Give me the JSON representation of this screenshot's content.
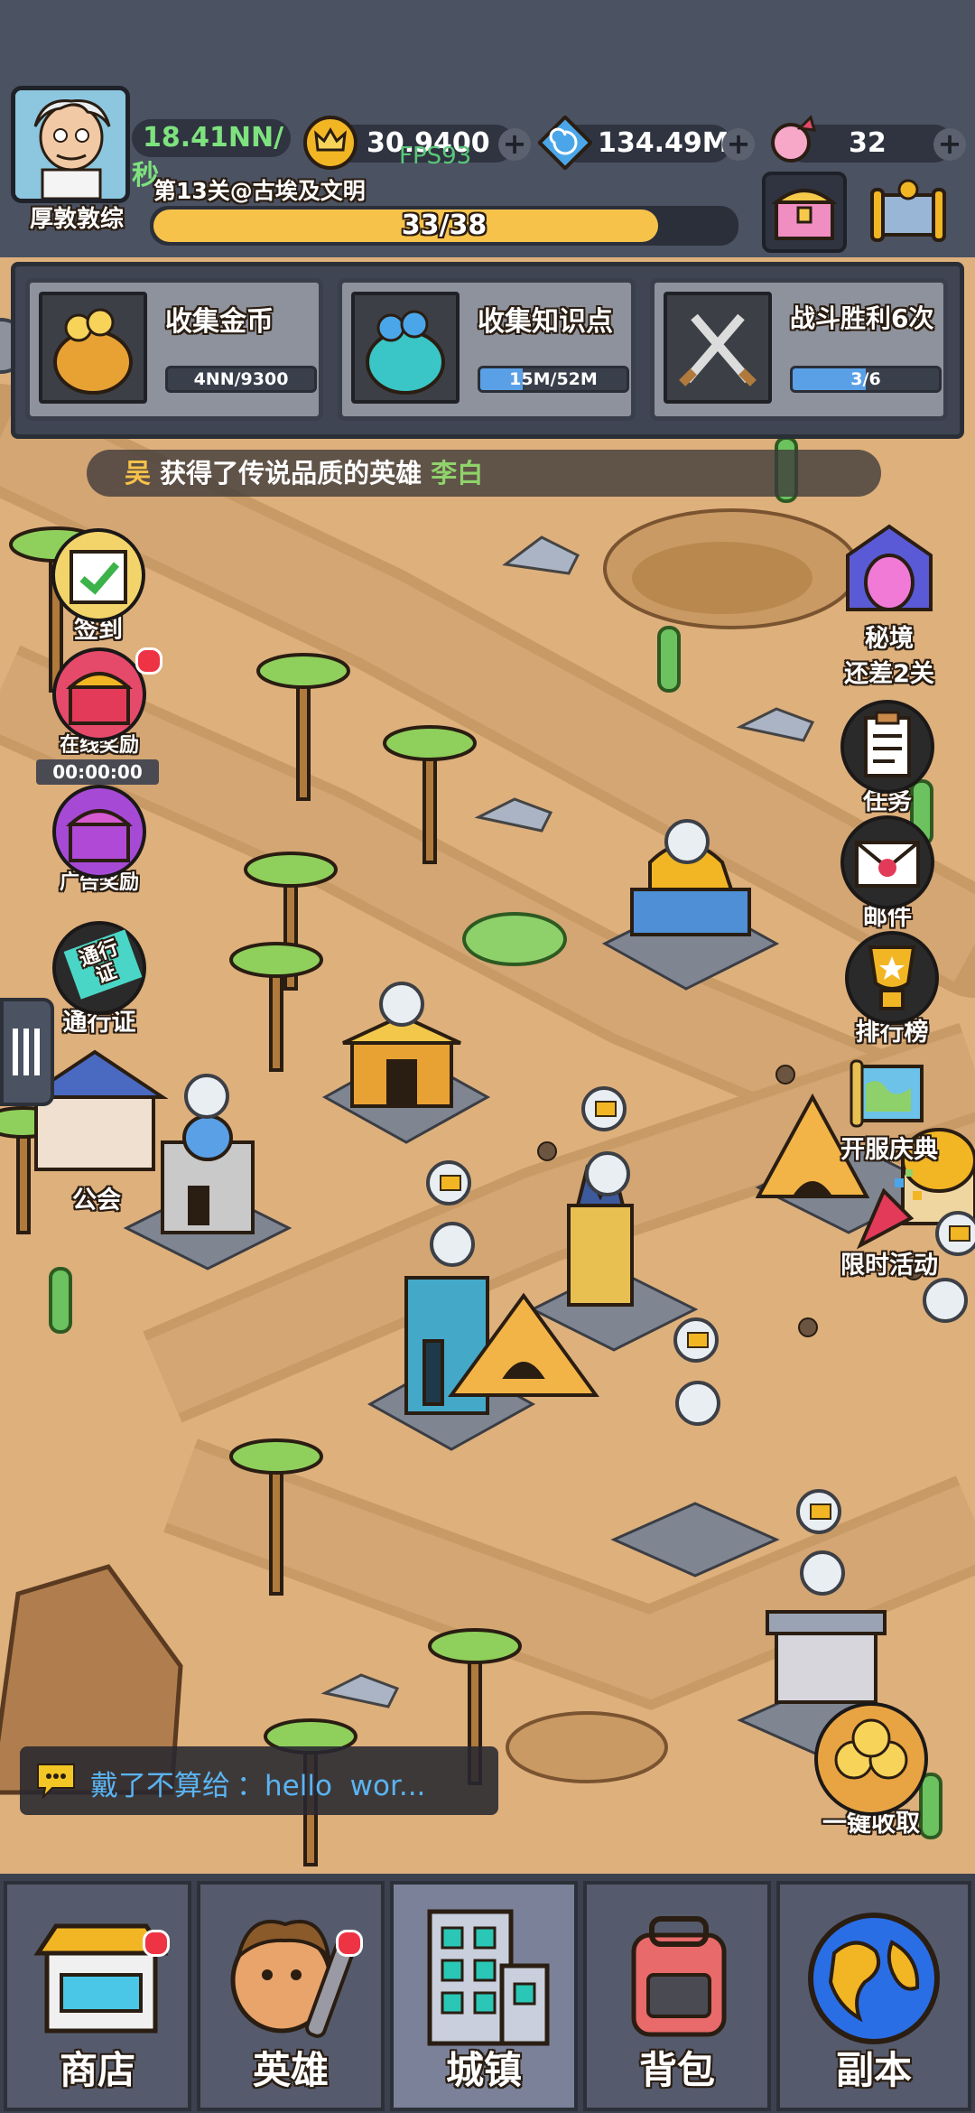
{
  "player": {
    "name": "厚敦敦综",
    "income": "18.41NN/秒"
  },
  "currencies": {
    "gold": "30.9400",
    "knowledge": "134.49M",
    "candy": "32"
  },
  "fps": "FPS93",
  "stage": {
    "label": "第13关@古埃及文明",
    "progress_text": "33/38",
    "progress": 0.868
  },
  "quests": [
    {
      "title": "收集金币",
      "progress_text": "4NN/9300",
      "progress": 0.0
    },
    {
      "title": "收集知识点",
      "progress_text": "15M/52M",
      "progress": 0.29
    },
    {
      "title": "战斗胜利6次",
      "progress_text": "3/6",
      "progress": 0.5
    }
  ],
  "announcement": {
    "user": "吴",
    "middle": "获得了传说品质的英雄",
    "hero": "李白"
  },
  "left_buttons": {
    "signin": "签到",
    "online_reward": "在线奖励",
    "online_timer": "00:00:00",
    "ad_reward": "广告奖励",
    "pass_badge": "通行证",
    "pass": "通行证",
    "guild": "公会"
  },
  "right_buttons": {
    "secret_realm": "秘境",
    "secret_realm_sub": "还差2关",
    "tasks": "任务",
    "mail": "邮件",
    "ranking": "排行榜",
    "celebration": "开服庆典",
    "limited_event": "限时活动",
    "collect_all": "一键收取"
  },
  "chat": {
    "sender": "戴了不算给",
    "message": "：hello  wor..."
  },
  "bottom_nav": [
    {
      "label": "商店"
    },
    {
      "label": "英雄"
    },
    {
      "label": "城镇"
    },
    {
      "label": "背包"
    },
    {
      "label": "副本"
    }
  ],
  "colors": {
    "top_bg": "#4b5262",
    "sand": "#deb07c",
    "progress_yellow": "#f6c24a",
    "quest_blue": "#5aa0e6",
    "income_green": "#7ee27e",
    "hero_name": "#8fd36a"
  }
}
